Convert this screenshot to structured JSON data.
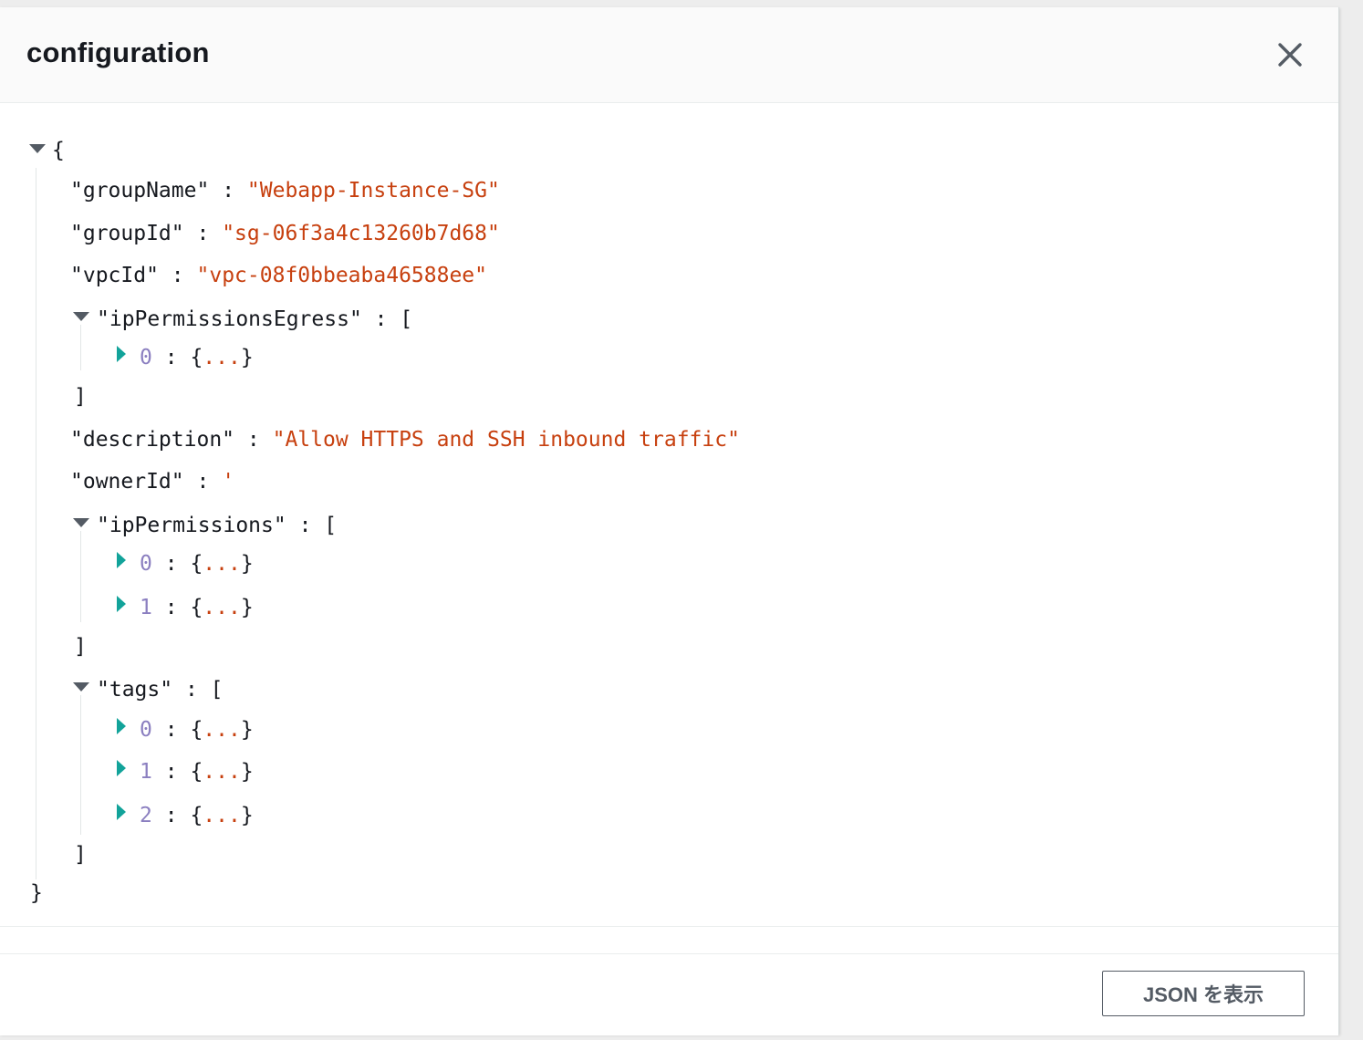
{
  "modal": {
    "title": "configuration",
    "close_icon": "close-icon"
  },
  "tree": {
    "root_open": "{",
    "root_close": "}",
    "fields": {
      "groupName": {
        "key": "\"groupName\"",
        "value": "\"Webapp-Instance-SG\""
      },
      "groupId": {
        "key": "\"groupId\"",
        "value": "\"sg-06f3a4c13260b7d68\""
      },
      "vpcId": {
        "key": "\"vpcId\"",
        "value": "\"vpc-08f0bbeaba46588ee\""
      },
      "ipPermissionsEgress": {
        "key": "\"ipPermissionsEgress\"",
        "items": [
          "0"
        ]
      },
      "description": {
        "key": "\"description\"",
        "value": "\"Allow HTTPS and SSH inbound traffic\""
      },
      "ownerId": {
        "key": "\"ownerId\"",
        "value": "'"
      },
      "ipPermissions": {
        "key": "\"ipPermissions\"",
        "items": [
          "0",
          "1"
        ]
      },
      "tags": {
        "key": "\"tags\"",
        "items": [
          "0",
          "1",
          "2"
        ]
      }
    },
    "colon": ":",
    "array_open": "[",
    "array_close": "]",
    "collapsed_open": "{",
    "collapsed_dots": "...",
    "collapsed_close": "}",
    "expanded_icon": "triangle-down-icon",
    "collapsed_icon": "triangle-right-icon"
  },
  "footer": {
    "show_json_label": "JSON を表示"
  },
  "colors": {
    "string_value": "#c7400f",
    "index": "#8b7fc0",
    "expand_toggle": "#12a39a",
    "collapse_toggle": "#545b64"
  }
}
